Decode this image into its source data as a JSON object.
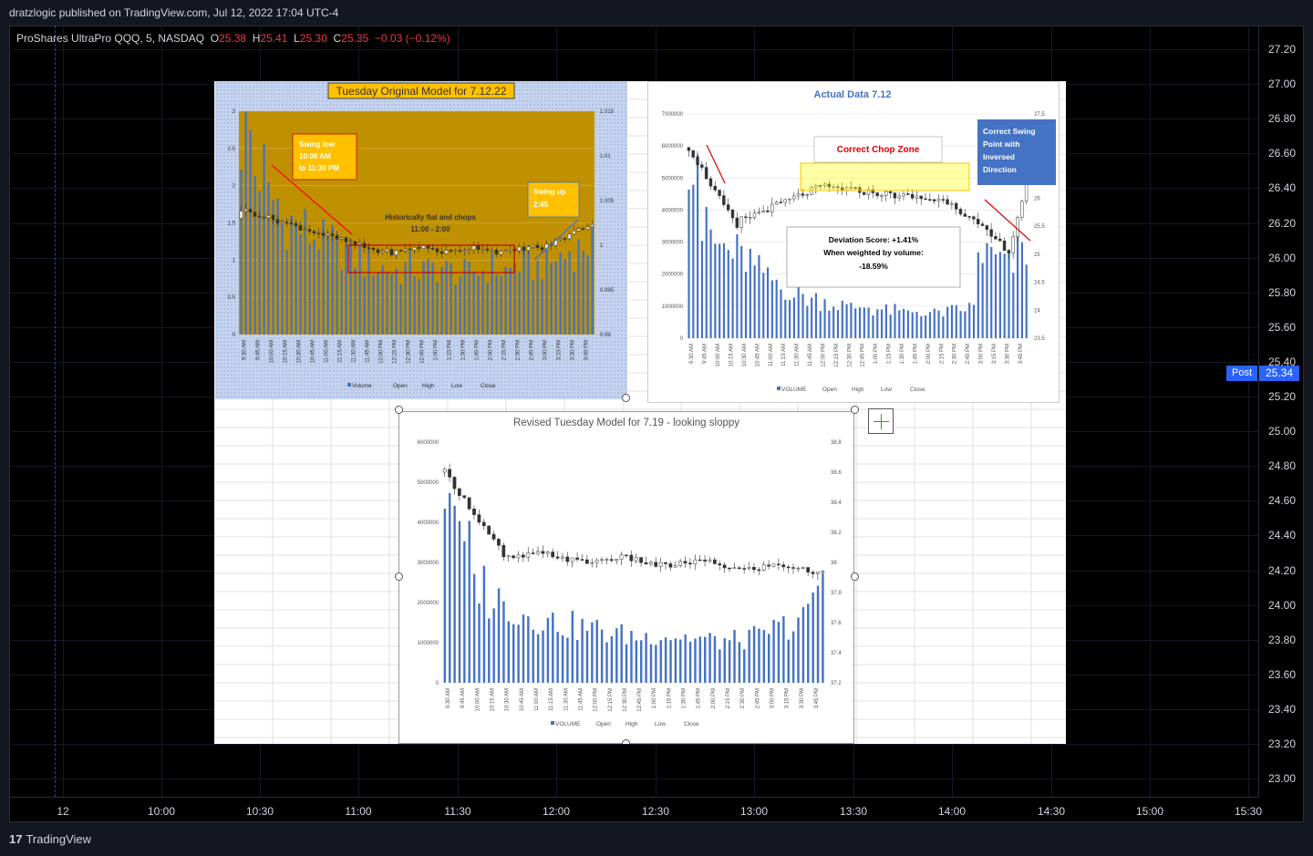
{
  "header": {
    "published": "dratzlogic published on TradingView.com, Jul 12, 2022 17:04 UTC-4"
  },
  "legend": {
    "symbol": "ProShares UltraPro QQQ, 5, NASDAQ",
    "o_label": "O",
    "o_value": "25.38",
    "h_label": "H",
    "h_value": "25.41",
    "l_label": "L",
    "l_value": "25.30",
    "c_label": "C",
    "c_value": "25.35",
    "change": "−0.03 (−0.12%)"
  },
  "price_axis": [
    "27.20",
    "27.00",
    "26.80",
    "26.60",
    "26.40",
    "26.20",
    "26.00",
    "25.80",
    "25.60",
    "25.40",
    "25.20",
    "25.00",
    "24.80",
    "24.60",
    "24.40",
    "24.20",
    "24.00",
    "23.80",
    "23.60",
    "23.40",
    "23.20",
    "23.00"
  ],
  "post": {
    "label": "Post",
    "price": "25.34"
  },
  "time_axis": [
    "12",
    "10:00",
    "10:30",
    "11:00",
    "11:30",
    "12:00",
    "12:30",
    "13:00",
    "13:30",
    "14:00",
    "14:30",
    "15:00",
    "15:30"
  ],
  "footer": {
    "brand": "TradingView",
    "logo": "17"
  },
  "colors": {
    "bg": "#000000",
    "post": "#2962ff",
    "down": "#f23645",
    "volume": "#4472c4",
    "chop_box": "#c00000"
  },
  "chart_data": [
    {
      "type": "bar",
      "title": "Tuesday Original Model for 7.12.22",
      "x_labels": [
        "9:30 AM",
        "9:45 AM",
        "10:00 AM",
        "10:15 AM",
        "10:30 AM",
        "10:45 AM",
        "11:00 AM",
        "11:15 AM",
        "11:30 AM",
        "11:45 AM",
        "12:00 PM",
        "12:15 PM",
        "12:30 PM",
        "12:45 PM",
        "1:00 PM",
        "1:15 PM",
        "1:30 PM",
        "1:45 PM",
        "2:00 PM",
        "2:15 PM",
        "2:30 PM",
        "2:45 PM",
        "3:00 PM",
        "3:15 PM",
        "3:30 PM",
        "3:45 PM"
      ],
      "y_left_ticks": [
        "3",
        "2.5",
        "2",
        "1.5",
        "1",
        "0.5",
        "0"
      ],
      "y_right_ticks": [
        "1.015",
        "1.01",
        "1.005",
        "1",
        "0.995",
        "0.99"
      ],
      "legend": [
        "Volume",
        "Open",
        "High",
        "Low",
        "Close"
      ],
      "annotations": [
        "Swing low 10:00 AM to 11:30 PM",
        "Historically flat and chops 11:00 - 2:00",
        "Swing up 2:45"
      ],
      "volume": [
        2.8,
        2.3,
        1.9,
        1.6,
        1.5,
        1.4,
        1.3,
        1.2,
        1.1,
        1.0,
        0.95,
        0.9,
        0.95,
        0.9,
        0.95,
        0.9,
        0.85,
        0.9,
        0.95,
        0.9,
        1.0,
        0.95,
        1.0,
        1.1,
        1.2,
        1.3
      ]
    },
    {
      "type": "bar",
      "title": "Actual Data 7.12",
      "x_labels": [
        "9:30 AM",
        "9:45 AM",
        "10:00 AM",
        "10:15 AM",
        "10:30 AM",
        "10:45 AM",
        "11:00 AM",
        "11:15 AM",
        "11:30 AM",
        "11:45 AM",
        "12:00 PM",
        "12:15 PM",
        "12:30 PM",
        "12:45 PM",
        "1:00 PM",
        "1:15 PM",
        "1:30 PM",
        "1:45 PM",
        "2:00 PM",
        "2:15 PM",
        "2:30 PM",
        "2:45 PM",
        "3:00 PM",
        "3:15 PM",
        "3:30 PM",
        "3:45 PM"
      ],
      "y_left_ticks": [
        "7000000",
        "6000000",
        "5000000",
        "4000000",
        "3000000",
        "2000000",
        "1000000",
        "0"
      ],
      "y_right_ticks": [
        "27.5",
        "27",
        "26.5",
        "26",
        "25.5",
        "25",
        "24.5",
        "24",
        "23.5"
      ],
      "legend": [
        "VOLUME",
        "Open",
        "High",
        "Low",
        "Close"
      ],
      "annotations": [
        "Correct Chop Zone",
        "Correct Swing Point with Inversed Direction",
        "Deviation Score: +1.41%",
        "When weighted by volume:",
        "-18.59%"
      ],
      "volume": [
        6500000,
        3500000,
        3000000,
        2800000,
        2600000,
        2200000,
        1900000,
        1600000,
        1400000,
        1300000,
        1200000,
        1100000,
        1000000,
        1050000,
        950000,
        900000,
        850000,
        900000,
        800000,
        850000,
        900000,
        1000000,
        2800000,
        2600000,
        2400000,
        2900000
      ]
    },
    {
      "type": "bar",
      "title": "Revised Tuesday Model for 7.19 - looking sloppy",
      "x_labels": [
        "9:30 AM",
        "9:45 AM",
        "10:00 AM",
        "10:15 AM",
        "10:30 AM",
        "10:45 AM",
        "11:00 AM",
        "11:15 AM",
        "11:30 AM",
        "11:45 AM",
        "12:00 PM",
        "12:15 PM",
        "12:30 PM",
        "12:45 PM",
        "1:00 PM",
        "1:15 PM",
        "1:30 PM",
        "1:45 PM",
        "2:00 PM",
        "2:15 PM",
        "2:30 PM",
        "2:45 PM",
        "3:00 PM",
        "3:15 PM",
        "3:30 PM",
        "3:45 PM"
      ],
      "y_left_ticks": [
        "6000000",
        "5000000",
        "4000000",
        "3000000",
        "2000000",
        "1000000",
        "0"
      ],
      "y_right_ticks": [
        "38.8",
        "38.6",
        "38.4",
        "38.2",
        "38",
        "37.8",
        "37.6",
        "37.4",
        "37.2"
      ],
      "legend": [
        "VOLUME",
        "Open",
        "High",
        "Low",
        "Close"
      ],
      "volume": [
        5200000,
        3500000,
        2600000,
        2200000,
        2000000,
        1800000,
        1700000,
        1600000,
        1500000,
        1450000,
        1400000,
        1300000,
        1250000,
        1200000,
        1300000,
        1250000,
        1200000,
        1150000,
        1100000,
        1100000,
        1150000,
        1200000,
        1400000,
        1500000,
        1700000,
        2500000
      ]
    }
  ]
}
